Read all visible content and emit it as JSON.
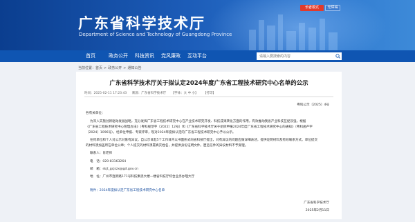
{
  "header": {
    "title": "广东省科学技术厅",
    "subtitle": "Department of Science and Technology of Guangdong Province",
    "btn_elderly": "长者模式",
    "btn_accessible": "无障碍"
  },
  "nav": {
    "items": [
      "首页",
      "政务公开",
      "科技资讯",
      "党风廉政",
      "互动平台"
    ],
    "search_placeholder": "请输入要搜索的内容"
  },
  "breadcrumb": [
    "当前位置：首页",
    "政务公开",
    "通知公告"
  ],
  "article": {
    "title": "广东省科学技术厅关于拟认定2024年度广东省工程技术研究中心名单的公示",
    "meta": {
      "date": "时间：2025-02-11 17:23:43",
      "source": "来源：广东省科学技术厅",
      "font": "【字体：大 中 小】",
      "print": "【打印】"
    },
    "doc_no": "粤科公示〔2025〕4号",
    "salutation": "各有关单位：",
    "para1": [
      "为深入实施创新驱动发展战略，充分发挥广东省工程技术研究中心在产业技术研究开发、科技成果转化方面的作用，有效推动我省产业科技互促双强，根据",
      "《广东省工程技术研究中心管理办法》（粤科规范字〔2022〕12号）和《广东省科学技术厅关于组织申报2024年度广东省工程技术研究中心的通知》（粤科函产字",
      "〔2024〕1096号），经单位申报、专家评审，现对2024年度拟认定的广东省工程技术研究中心予以公示。"
    ],
    "para2": [
      "任何单位和个人对公示对象有异议，自公示日起5个工作日内以书面形式向省科技厅提出，对有异议的问题应做详细表述，提供证明材料及有效联系方式。单位提交",
      "的材料须加盖所在单位公章；个人提交的材料须署真实姓名，并提供身份证明文件。匿名信件的异议材料不予受理。"
    ],
    "contact": {
      "person": "联系人：肖老师",
      "phone": "电　话：020-83163264",
      "email": "邮　箱：skjt_gcjszx@gd.gov.cn",
      "address": "地　址：广州市连新路171号科技集思大楼一楼省科技厅综合业务办理大厅"
    },
    "attachment": "附件：2024年度拟认定广东省工程技术研究中心名单",
    "signature": "广东省科学技术厅",
    "sign_date": "2025年2月11日"
  }
}
